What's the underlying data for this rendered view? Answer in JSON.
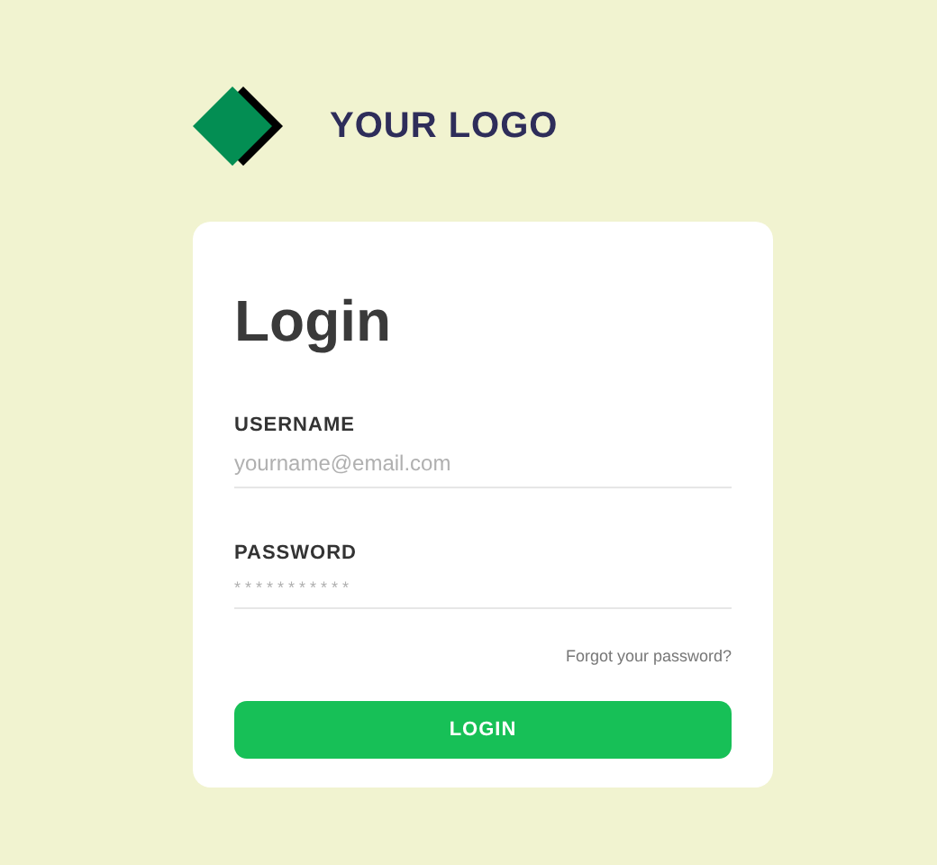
{
  "logo": {
    "text": "YOUR LOGO"
  },
  "form": {
    "title": "Login",
    "fields": [
      {
        "label": "USERNAME",
        "placeholder": "yourname@email.com",
        "kind": "text"
      },
      {
        "label": "PASSWORD",
        "placeholder": "***********",
        "kind": "password"
      }
    ],
    "forgot_link": "Forgot your password?",
    "submit": "LOGIN"
  }
}
